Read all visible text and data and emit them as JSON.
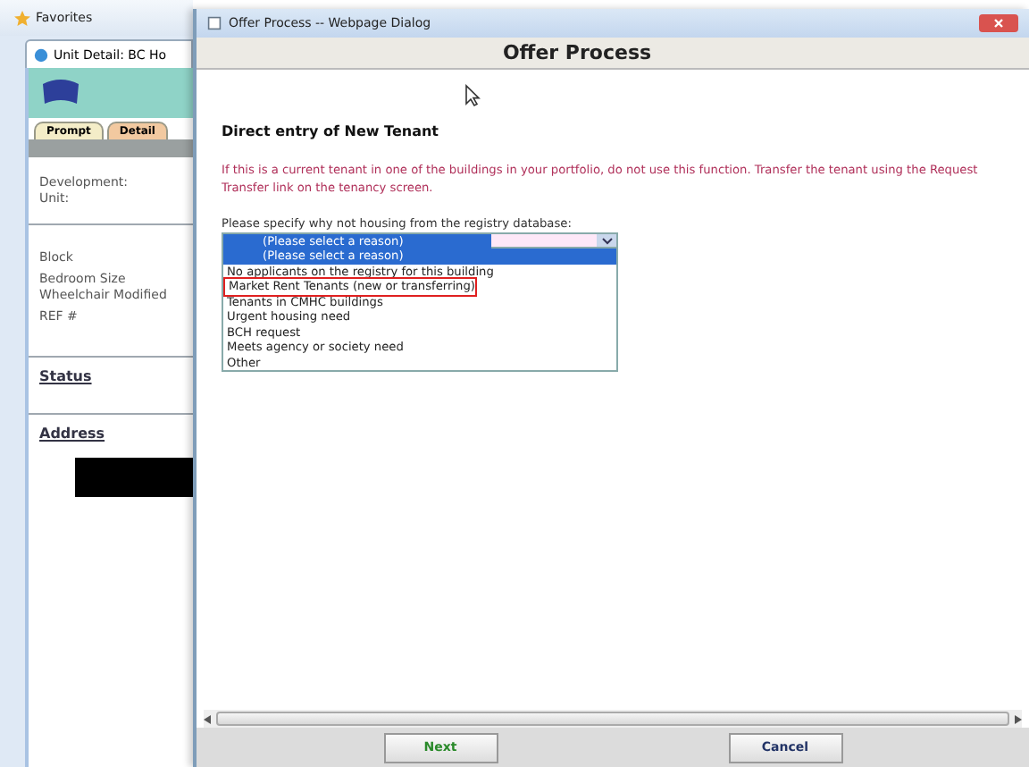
{
  "browser": {
    "favorites": "Favorites",
    "tab": "Unit Detail: BC Ho",
    "page_tabs": [
      {
        "label": "Prompt",
        "selected": false
      },
      {
        "label": "Detail",
        "selected": true
      }
    ],
    "fields": [
      "Development:",
      "Unit:"
    ],
    "details": [
      "Block",
      "Bedroom Size",
      "Wheelchair Modified",
      "REF #"
    ],
    "sections": [
      "Status",
      "Address"
    ]
  },
  "dialog": {
    "title": "Offer Process -- Webpage Dialog",
    "header": "Offer Process",
    "heading": "Direct entry of New Tenant",
    "warning": "If this is a current tenant in one of the buildings in your portfolio, do not use this function. Transfer the tenant using the Request Transfer link on the tenancy screen.",
    "prompt": "Please specify why not housing from the registry database:",
    "select_value": "(Please select a reason)",
    "options": [
      {
        "label": "(Please select a reason)",
        "selected": true,
        "annotated": false
      },
      {
        "label": "No applicants on the registry for this building",
        "selected": false,
        "annotated": false
      },
      {
        "label": "Market Rent Tenants (new or transferring)",
        "selected": false,
        "annotated": true
      },
      {
        "label": "Tenants in CMHC buildings",
        "selected": false,
        "annotated": false
      },
      {
        "label": "Urgent housing need",
        "selected": false,
        "annotated": false
      },
      {
        "label": "BCH request",
        "selected": false,
        "annotated": false
      },
      {
        "label": "Meets agency or society need",
        "selected": false,
        "annotated": false
      },
      {
        "label": "Other",
        "selected": false,
        "annotated": false
      }
    ],
    "buttons": [
      {
        "label": "Next",
        "kind": "primary"
      },
      {
        "label": "Cancel",
        "kind": "secondary"
      }
    ]
  }
}
